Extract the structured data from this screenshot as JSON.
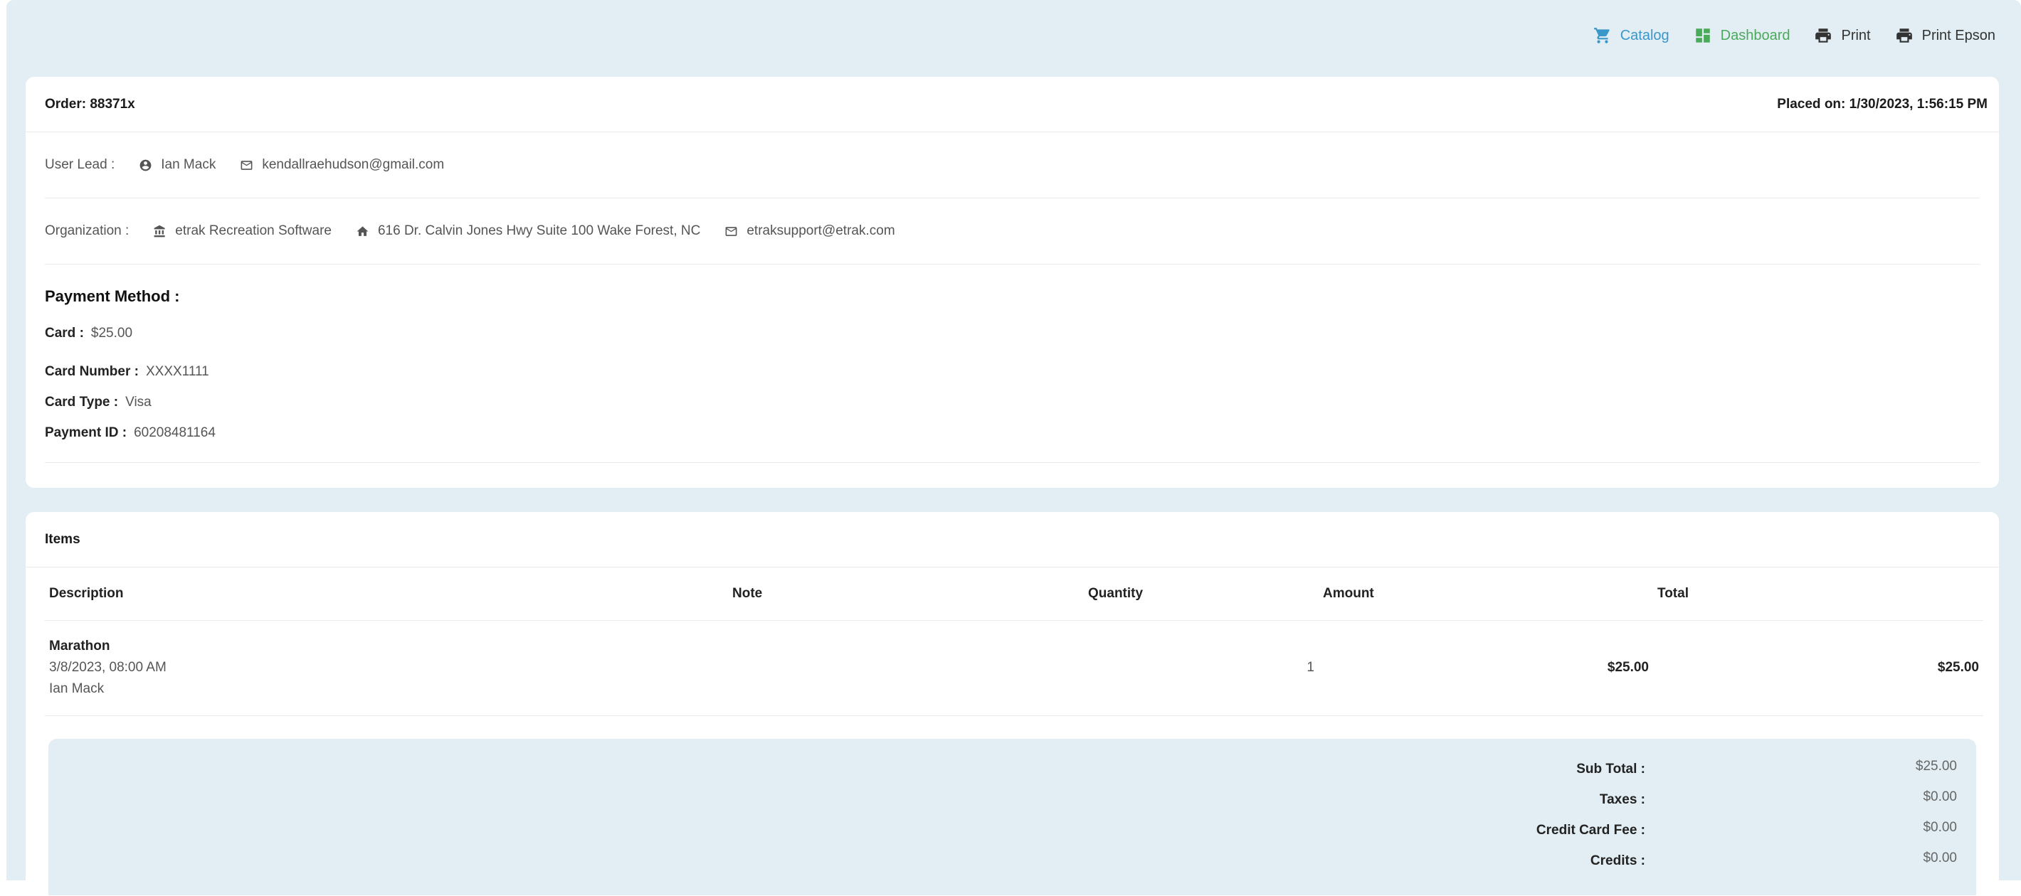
{
  "topbar": {
    "catalog": "Catalog",
    "dashboard": "Dashboard",
    "print": "Print",
    "print_epson": "Print Epson"
  },
  "order": {
    "title": "Order: 88371x",
    "placed_on": "Placed on: 1/30/2023, 1:56:15 PM"
  },
  "user_lead": {
    "label": "User Lead :",
    "name": "Ian Mack",
    "email": "kendallraehudson@gmail.com"
  },
  "organization": {
    "label": "Organization :",
    "name": "etrak Recreation Software",
    "address": "616 Dr. Calvin Jones Hwy Suite 100 Wake Forest, NC",
    "email": "etraksupport@etrak.com"
  },
  "payment": {
    "title": "Payment Method :",
    "card_label": "Card :",
    "card_value": "$25.00",
    "number_label": "Card Number :",
    "number_value": "XXXX1111",
    "type_label": "Card Type :",
    "type_value": "Visa",
    "id_label": "Payment ID :",
    "id_value": "60208481164"
  },
  "items": {
    "title": "Items",
    "columns": {
      "description": "Description",
      "note": "Note",
      "quantity": "Quantity",
      "amount": "Amount",
      "total": "Total"
    },
    "rows": [
      {
        "title": "Marathon",
        "datetime": "3/8/2023, 08:00 AM",
        "participant": "Ian Mack",
        "note": "",
        "quantity": "1",
        "amount": "$25.00",
        "total": "$25.00"
      }
    ]
  },
  "totals": {
    "subtotal_label": "Sub Total :",
    "subtotal": "$25.00",
    "taxes_label": "Taxes :",
    "taxes": "$0.00",
    "cc_fee_label": "Credit Card Fee :",
    "cc_fee": "$0.00",
    "credits_label": "Credits :",
    "credits": "$0.00"
  },
  "colors": {
    "background": "#e2eef3",
    "catalog": "#3a97c9",
    "dashboard": "#4aaa5a"
  }
}
